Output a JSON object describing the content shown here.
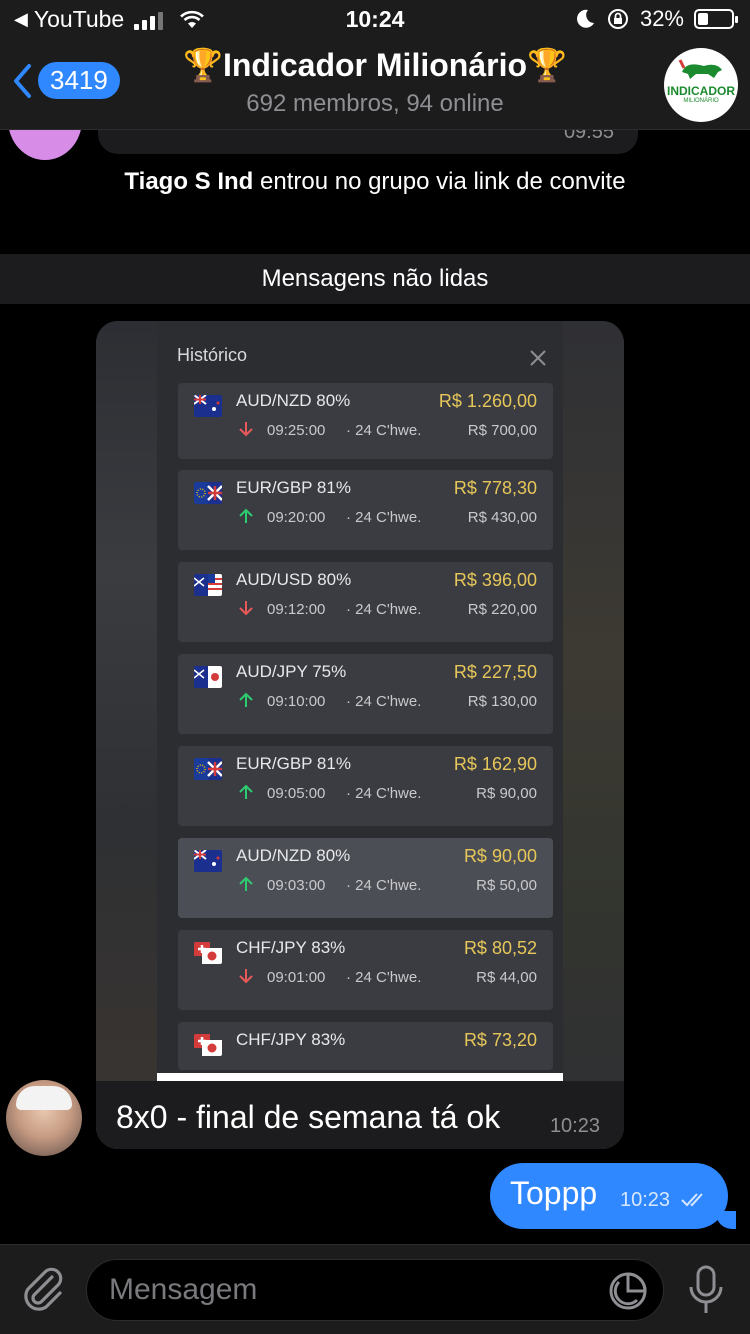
{
  "status_bar": {
    "back_app": "YouTube",
    "time": "10:24",
    "battery": "32%",
    "battery_level": 0.32
  },
  "header": {
    "unread_count": "3419",
    "title": "🏆Indicador Milionário🏆",
    "subtitle": "692 membros, 94 online",
    "avatar_text": "INDICADOR",
    "avatar_subtext": "MILIONÁRIO"
  },
  "chat": {
    "previous_time": "09:55",
    "service_user": "Tiago S Ind",
    "service_text": " entrou no grupo via link de convite",
    "unread_divider": "Mensagens não lidas",
    "photo": {
      "panel_title": "Histórico",
      "trades": [
        {
          "pair": "AUD/NZD 80%",
          "time": "09:25:00",
          "when": "· 24 C'hwe.",
          "profit": "R$ 1.260,00",
          "amount": "R$ 700,00",
          "direction": "down",
          "flag": "au-nz"
        },
        {
          "pair": "EUR/GBP  81%",
          "time": "09:20:00",
          "when": "· 24 C'hwe.",
          "profit": "R$ 778,30",
          "amount": "R$ 430,00",
          "direction": "up",
          "flag": "eu-gb"
        },
        {
          "pair": "AUD/USD 80%",
          "time": "09:12:00",
          "when": "· 24 C'hwe.",
          "profit": "R$ 396,00",
          "amount": "R$ 220,00",
          "direction": "down",
          "flag": "au-us"
        },
        {
          "pair": "AUD/JPY 75%",
          "time": "09:10:00",
          "when": "· 24 C'hwe.",
          "profit": "R$ 227,50",
          "amount": "R$ 130,00",
          "direction": "up",
          "flag": "au-jp"
        },
        {
          "pair": "EUR/GBP  81%",
          "time": "09:05:00",
          "when": "· 24 C'hwe.",
          "profit": "R$ 162,90",
          "amount": "R$ 90,00",
          "direction": "up",
          "flag": "eu-gb"
        },
        {
          "pair": "AUD/NZD 80%",
          "time": "09:03:00",
          "when": "· 24 C'hwe.",
          "profit": "R$ 90,00",
          "amount": "R$ 50,00",
          "direction": "up",
          "flag": "au-nz"
        },
        {
          "pair": "CHF/JPY  83%",
          "time": "09:01:00",
          "when": "· 24 C'hwe.",
          "profit": "R$ 80,52",
          "amount": "R$ 44,00",
          "direction": "down",
          "flag": "ch-jp"
        },
        {
          "pair": "CHF/JPY  83%",
          "time": "",
          "when": "",
          "profit": "R$ 73,20",
          "amount": "",
          "direction": "",
          "flag": "ch-jp"
        }
      ]
    },
    "caption": "8x0 - final de semana tá ok",
    "caption_time": "10:23",
    "outgoing": {
      "text": "Toppp",
      "time": "10:23"
    }
  },
  "input": {
    "placeholder": "Mensagem"
  },
  "colors": {
    "accent": "#2f88ff",
    "profit": "#e7c75a",
    "up": "#2ecc71",
    "down": "#e8595a"
  }
}
